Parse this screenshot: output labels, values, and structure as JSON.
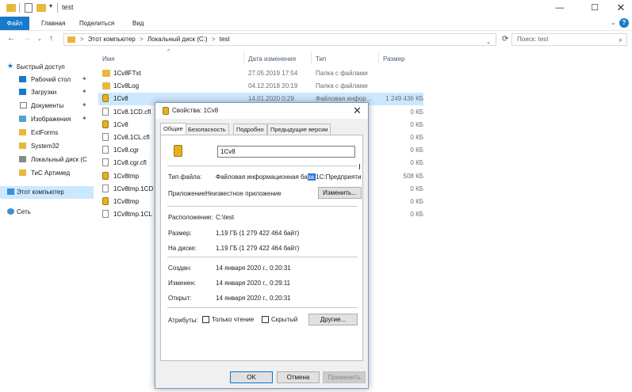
{
  "window": {
    "title": "test",
    "minimize": "—",
    "maximize": "☐",
    "close": "✕"
  },
  "quick_access": {
    "dropdown": "▾"
  },
  "ribbon": {
    "tabs": [
      "Файл",
      "Главная",
      "Поделиться",
      "Вид"
    ],
    "expand": "⌄",
    "help": "?"
  },
  "nav": {
    "back": "←",
    "forward": "→",
    "recent": "⌄",
    "up": "↑",
    "breadcrumb": [
      "Этот компьютер",
      "Локальный диск (C:)",
      "test"
    ],
    "separator": ">",
    "addr_dropdown": "⌄",
    "refresh": "⟳",
    "search_placeholder": "Поиск: test",
    "search_icon": "⌕"
  },
  "sidebar": {
    "items": [
      {
        "label": "Быстрый доступ",
        "icon": "star-icon",
        "pinned": false
      },
      {
        "label": "Рабочий стол",
        "icon": "desktop-icon",
        "pinned": true
      },
      {
        "label": "Загрузки",
        "icon": "download-icon",
        "pinned": true
      },
      {
        "label": "Документы",
        "icon": "documents-icon",
        "pinned": true
      },
      {
        "label": "Изображения",
        "icon": "pictures-icon",
        "pinned": true
      },
      {
        "label": "ExtForms",
        "icon": "folder-icon",
        "pinned": false
      },
      {
        "label": "System32",
        "icon": "folder-icon",
        "pinned": false
      },
      {
        "label": "Локальный диск (C",
        "icon": "drive-icon",
        "pinned": false
      },
      {
        "label": "ТиС Артимед",
        "icon": "folder-icon",
        "pinned": false
      },
      {
        "label": "Этот компьютер",
        "icon": "computer-icon",
        "pinned": false
      },
      {
        "label": "Сеть",
        "icon": "network-icon",
        "pinned": false
      }
    ],
    "pin_glyph": "📌"
  },
  "filelist": {
    "sort_arrow": "^",
    "columns": {
      "name": "Имя",
      "date": "Дата изменения",
      "type": "Тип",
      "size": "Размер"
    },
    "rows": [
      {
        "name": "1Cv8FTxt",
        "date": "27.05.2019 17:54",
        "type": "Папка с файлами",
        "size": "",
        "kind": "folder"
      },
      {
        "name": "1Cv8Log",
        "date": "04.12.2018 20:19",
        "type": "Папка с файлами",
        "size": "",
        "kind": "folder"
      },
      {
        "name": "1Cv8",
        "date": "14.01.2020 0:29",
        "type": "Файловая инфор...",
        "size": "1 249 436 КБ",
        "kind": "db"
      },
      {
        "name": "1Cv8.1CD.cfl",
        "date": "",
        "type": "",
        "size": "0 КБ",
        "kind": "file"
      },
      {
        "name": "1Cv8",
        "date": "",
        "type": "",
        "size": "0 КБ",
        "kind": "db"
      },
      {
        "name": "1Cv8.1CL.cfl",
        "date": "",
        "type": "",
        "size": "0 КБ",
        "kind": "file"
      },
      {
        "name": "1Cv8.cgr",
        "date": "",
        "type": "",
        "size": "0 КБ",
        "kind": "file"
      },
      {
        "name": "1Cv8.cgr.cfl",
        "date": "",
        "type": "",
        "size": "0 КБ",
        "kind": "file"
      },
      {
        "name": "1Cv8tmp",
        "date": "",
        "type": "",
        "size": "508 КБ",
        "kind": "db"
      },
      {
        "name": "1Cv8tmp.1CD",
        "date": "",
        "type": "",
        "size": "0 КБ",
        "kind": "file"
      },
      {
        "name": "1Cv8tmp",
        "date": "",
        "type": "",
        "size": "0 КБ",
        "kind": "db"
      },
      {
        "name": "1Cv8tmp.1CL",
        "date": "",
        "type": "",
        "size": "0 КБ",
        "kind": "file"
      }
    ]
  },
  "dialog": {
    "title": "Свойства: 1Cv8",
    "close": "✕",
    "tabs": [
      "Общие",
      "Безопасность",
      "Подробно",
      "Предыдущие версии"
    ],
    "name_value": "1Cv8",
    "file_type_label": "Тип файла:",
    "file_type_pre": "Файловая информационная ба",
    "file_type_hl": "за ",
    "file_type_post": "1С:Предприяти",
    "app_label": "Приложение:",
    "app_value": "Неизвестное приложение",
    "change_btn": "Изменить...",
    "location_label": "Расположение:",
    "location_value": "C:\\test",
    "size_label": "Размер:",
    "size_value": "1,19 ГБ (1 279 422 464 байт)",
    "disk_label": "На диске:",
    "disk_value": "1,19 ГБ (1 279 422 464 байт)",
    "created_label": "Создан:",
    "created_value": "14 января 2020 г., 0:20:31",
    "modified_label": "Изменен:",
    "modified_value": "14 января 2020 г., 0:29:11",
    "opened_label": "Открыт:",
    "opened_value": "14 января 2020 г., 0:20:31",
    "attrs_label": "Атрибуты:",
    "readonly_label": "Только чтение",
    "hidden_label": "Скрытый",
    "other_btn": "Другие...",
    "ok": "OK",
    "cancel": "Отмена",
    "apply": "Применить"
  },
  "cursor": "I"
}
